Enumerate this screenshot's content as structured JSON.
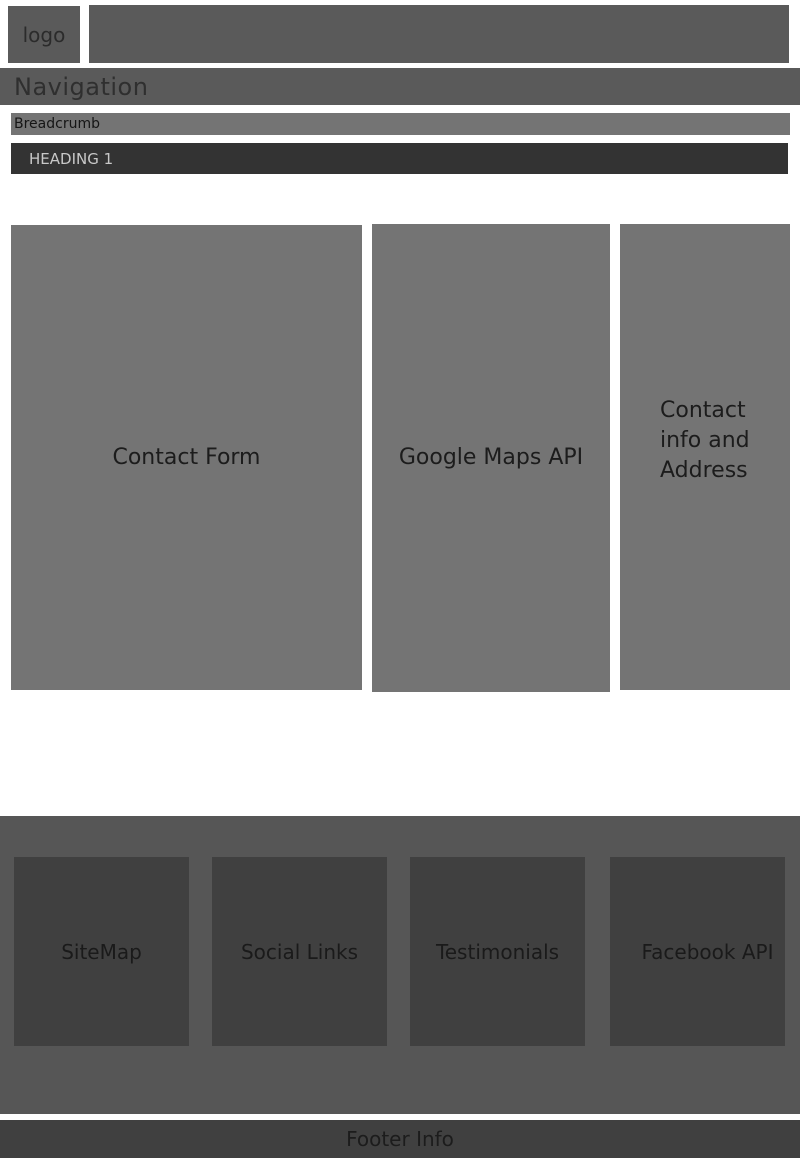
{
  "header": {
    "logo_label": "logo"
  },
  "navigation": {
    "label": "Navigation"
  },
  "breadcrumb": {
    "label": "Breadcrumb"
  },
  "heading": {
    "label": "HEADING 1"
  },
  "main": {
    "contact_form": "Contact Form",
    "maps": "Google Maps API",
    "contact_info": "Contact info and Address"
  },
  "footer": {
    "boxes": [
      "SiteMap",
      "Social Links",
      "Testimonials",
      "Facebook API"
    ],
    "info": "Footer Info"
  },
  "colors": {
    "block": "#5a5a5a",
    "panel": "#747474",
    "dark": "#333333",
    "footer_box": "#404040"
  }
}
